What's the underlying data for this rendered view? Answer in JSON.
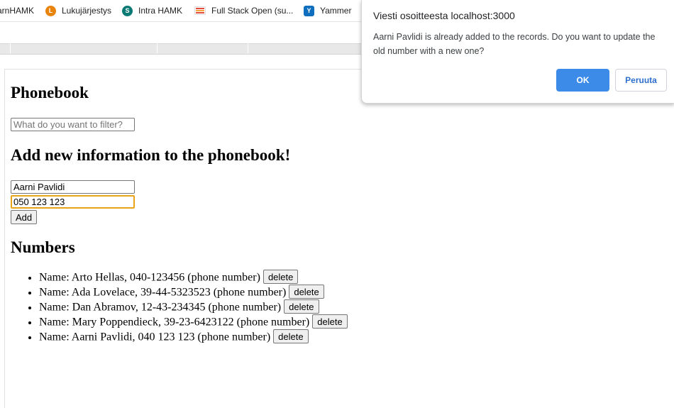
{
  "bookmarks": [
    {
      "label": "arnHAMK",
      "icon": "hamk-icon"
    },
    {
      "label": "Lukujärjestys",
      "icon": "lukujarjestys-icon",
      "color": "#e8830c",
      "glyph": "L"
    },
    {
      "label": "Intra HAMK",
      "icon": "sharepoint-icon",
      "color": "#0b7a75",
      "glyph": "S"
    },
    {
      "label": "Full Stack Open (su...",
      "icon": "fullstack-icon",
      "color": "#e64a3a"
    },
    {
      "label": "Yammer",
      "icon": "yammer-icon",
      "color": "#106ebe",
      "glyph": "Y"
    }
  ],
  "page": {
    "title": "Phonebook",
    "filter_placeholder": "What do you want to filter?",
    "add_heading": "Add new information to the phonebook!",
    "name_value": "Aarni Pavlidi",
    "number_value": "050 123 123",
    "add_label": "Add",
    "numbers_heading": "Numbers",
    "delete_label": "delete",
    "entries": [
      "Name: Arto Hellas, 040-123456 (phone number)",
      "Name: Ada Lovelace, 39-44-5323523 (phone number)",
      "Name: Dan Abramov, 12-43-234345 (phone number)",
      "Name: Mary Poppendieck, 39-23-6423122 (phone number)",
      "Name: Aarni Pavlidi, 040 123 123 (phone number)"
    ]
  },
  "dialog": {
    "title": "Viesti osoitteesta localhost:3000",
    "message": "Aarni Pavlidi is already added to the records. Do you want to update the old number with a new one?",
    "ok_label": "OK",
    "cancel_label": "Peruuta"
  },
  "colors": {
    "accent": "#3c8be8",
    "focus_outline": "#e8a317"
  }
}
